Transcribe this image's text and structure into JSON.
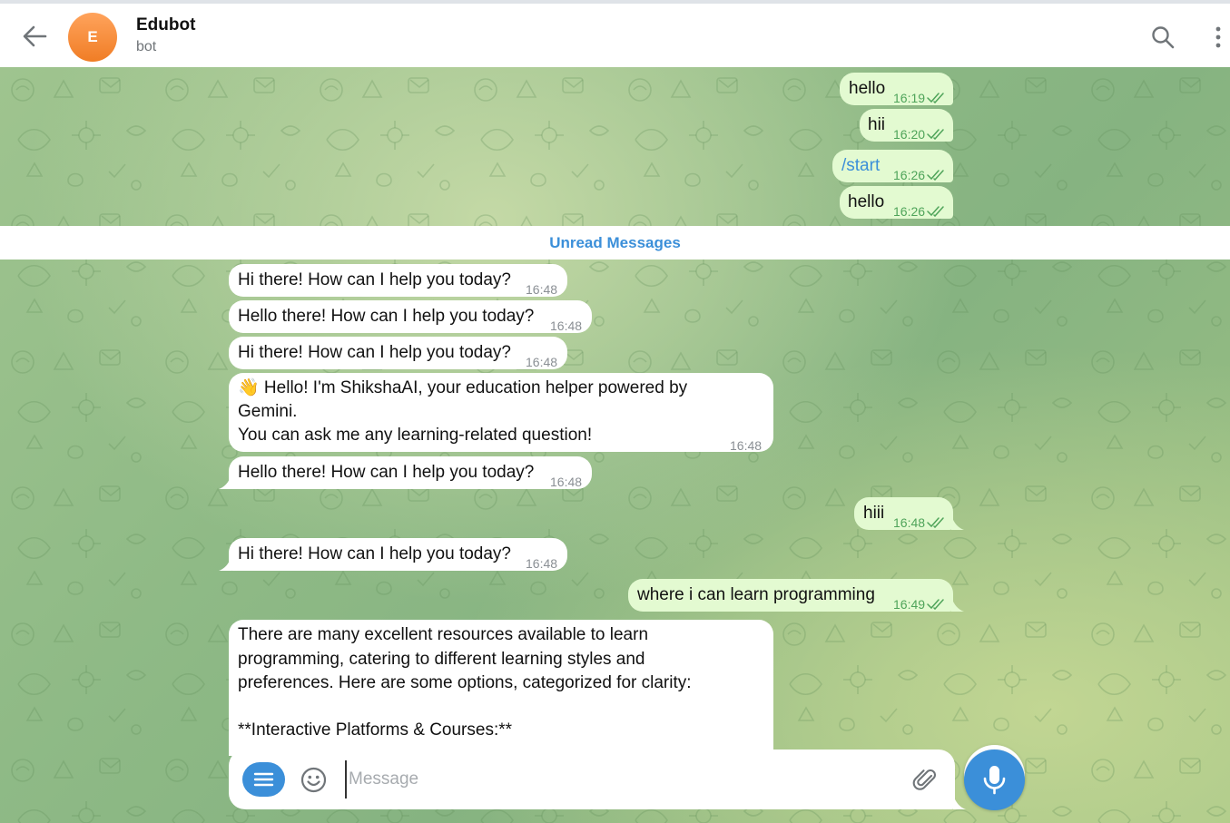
{
  "header": {
    "title": "Edubot",
    "subtitle": "bot",
    "avatar_letter": "E",
    "back_icon": "arrow-left-icon",
    "search_icon": "search-icon",
    "more_icon": "more-vertical-icon"
  },
  "unread_label": "Unread Messages",
  "messages": [
    {
      "dir": "out",
      "text": "hello",
      "time": "16:19",
      "read": true
    },
    {
      "dir": "out",
      "text": "hii",
      "time": "16:20",
      "read": true
    },
    {
      "dir": "out",
      "text": "/start",
      "time": "16:26",
      "read": true
    },
    {
      "dir": "out",
      "text": "hello",
      "time": "16:26",
      "read": true
    },
    {
      "dir": "in",
      "text": "Hi there! How can I help you today?",
      "time": "16:48"
    },
    {
      "dir": "in",
      "text": "Hello there! How can I help you today?",
      "time": "16:48"
    },
    {
      "dir": "in",
      "text": "Hi there! How can I help you today?",
      "time": "16:48"
    },
    {
      "dir": "in",
      "lines": [
        "👋 Hello! I'm ShikshaAI, your education helper powered by",
        "Gemini.",
        "You can ask me any learning-related question!"
      ],
      "time": "16:48"
    },
    {
      "dir": "in",
      "text": "Hello there! How can I help you today?",
      "time": "16:48"
    },
    {
      "dir": "out",
      "text": "hiii",
      "time": "16:48",
      "read": true
    },
    {
      "dir": "in",
      "text": "Hi there! How can I help you today?",
      "time": "16:48"
    },
    {
      "dir": "out",
      "text": "where i can learn programming",
      "time": "16:49",
      "read": true
    },
    {
      "dir": "in",
      "lines": [
        "There are many excellent resources available to learn",
        "programming, catering to different learning styles and",
        "preferences. Here are some options, categorized for clarity:",
        "",
        "**Interactive Platforms & Courses:**"
      ]
    }
  ],
  "composer": {
    "placeholder": "Message",
    "value": ""
  },
  "colors": {
    "accent": "#3b8fd9",
    "outgoing_bubble": "#e3fad1",
    "incoming_bubble": "#ffffff",
    "read_check": "#4fa45a"
  }
}
